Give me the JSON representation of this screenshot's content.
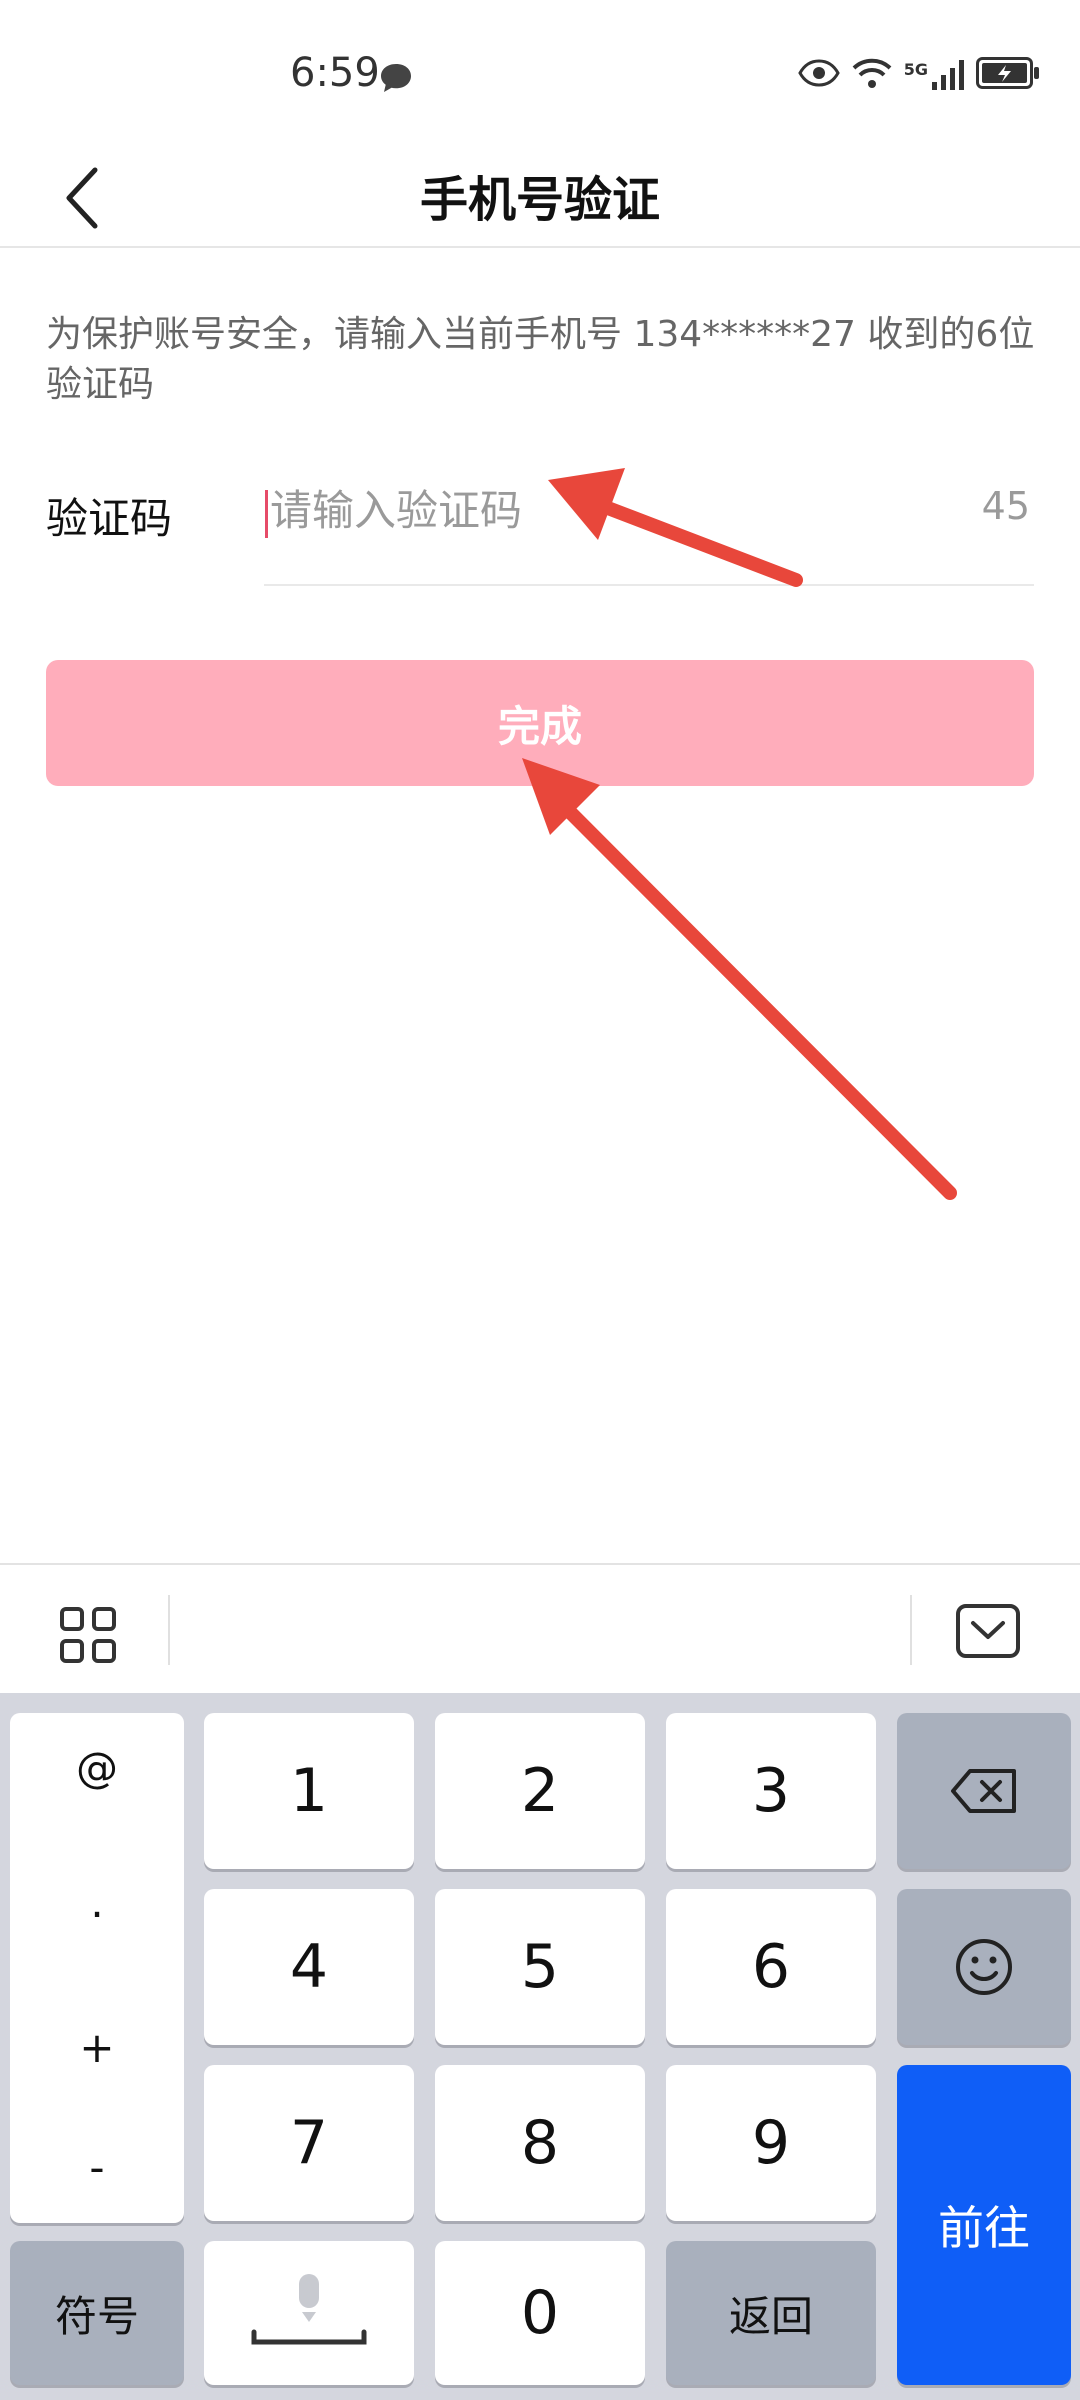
{
  "status_bar": {
    "time": "6:59",
    "network": "5G"
  },
  "header": {
    "title": "手机号验证"
  },
  "content": {
    "description": "为保护账号安全，请输入当前手机号 134******27 收到的6位验证码",
    "code_label": "验证码",
    "code_placeholder": "请输入验证码",
    "countdown": "45",
    "complete_button": "完成"
  },
  "keyboard": {
    "symbol_column": [
      "@",
      ".",
      "+",
      "-"
    ],
    "digits": [
      "1",
      "2",
      "3",
      "4",
      "5",
      "6",
      "7",
      "8",
      "9",
      "0"
    ],
    "symbols_key": "符号",
    "return_key": "返回",
    "go_key": "前往",
    "icons": {
      "backspace": "backspace-icon",
      "emoji": "emoji-icon",
      "mic": "microphone-icon",
      "grid": "grid-icon",
      "collapse": "keyboard-collapse-icon"
    }
  },
  "colors": {
    "accent": "#ffadbb",
    "caret": "#e64b68",
    "go_key": "#0f5ef7",
    "arrow": "#e8473b"
  }
}
